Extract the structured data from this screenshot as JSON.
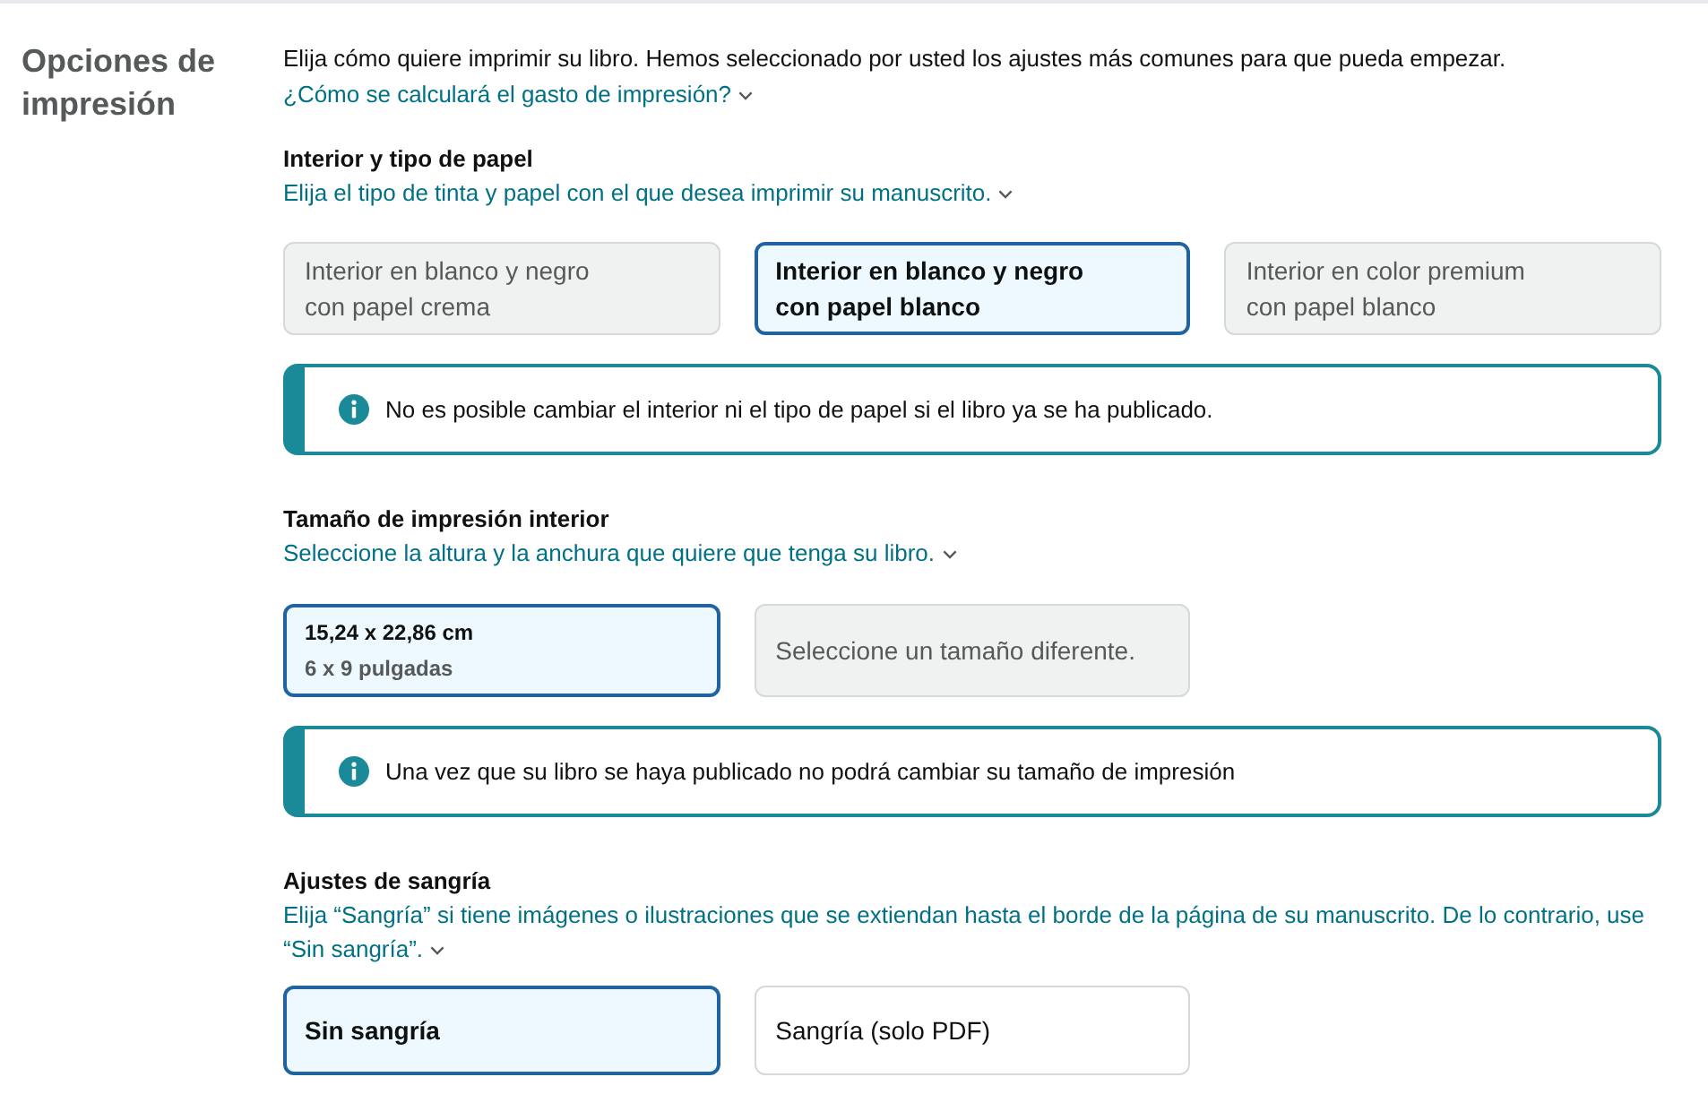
{
  "section": {
    "title": "Opciones de impresión",
    "intro": "Elija cómo quiere imprimir su libro. Hemos seleccionado por usted los ajustes más comunes para que pueda empezar.",
    "help_link": "¿Cómo se calculará el gasto de impresión?"
  },
  "groups": [
    {
      "heading": "Interior y tipo de papel",
      "help_link": "Elija el tipo de tinta y papel con el que desea imprimir su manuscrito.",
      "options": [
        {
          "kind": "text",
          "lines": [
            "Interior en blanco y negro",
            "con papel crema"
          ],
          "selected": false,
          "disabled": true
        },
        {
          "kind": "text",
          "lines": [
            "Interior en blanco y negro",
            "con papel blanco"
          ],
          "selected": true,
          "disabled": false
        },
        {
          "kind": "text",
          "lines": [
            "Interior en color premium",
            "con papel blanco"
          ],
          "selected": false,
          "disabled": true
        }
      ],
      "notice": "No es posible cambiar el interior ni el tipo de papel si el libro ya se ha publicado."
    },
    {
      "heading": "Tamaño de impresión interior",
      "help_link": "Seleccione la altura y la anchura que quiere que tenga su libro.",
      "options": [
        {
          "kind": "size",
          "title": "15,24 x 22,86 cm",
          "subtitle": "6 x 9 pulgadas",
          "selected": true,
          "disabled": false
        },
        {
          "kind": "text",
          "lines": [
            "Seleccione un tamaño diferente."
          ],
          "selected": false,
          "disabled": true
        }
      ],
      "notice": "Una vez que su libro se haya publicado no podrá cambiar su tamaño de impresión"
    },
    {
      "heading": "Ajustes de sangría",
      "help_link": "Elija “Sangría” si tiene imágenes o ilustraciones que se extiendan hasta el borde de la página de su manuscrito. De lo contrario, use “Sin sangría”.",
      "options": [
        {
          "kind": "text",
          "lines": [
            "Sin sangría"
          ],
          "selected": true,
          "disabled": false
        },
        {
          "kind": "text",
          "lines": [
            "Sangría (solo PDF)"
          ],
          "selected": false,
          "disabled": false
        }
      ]
    }
  ]
}
